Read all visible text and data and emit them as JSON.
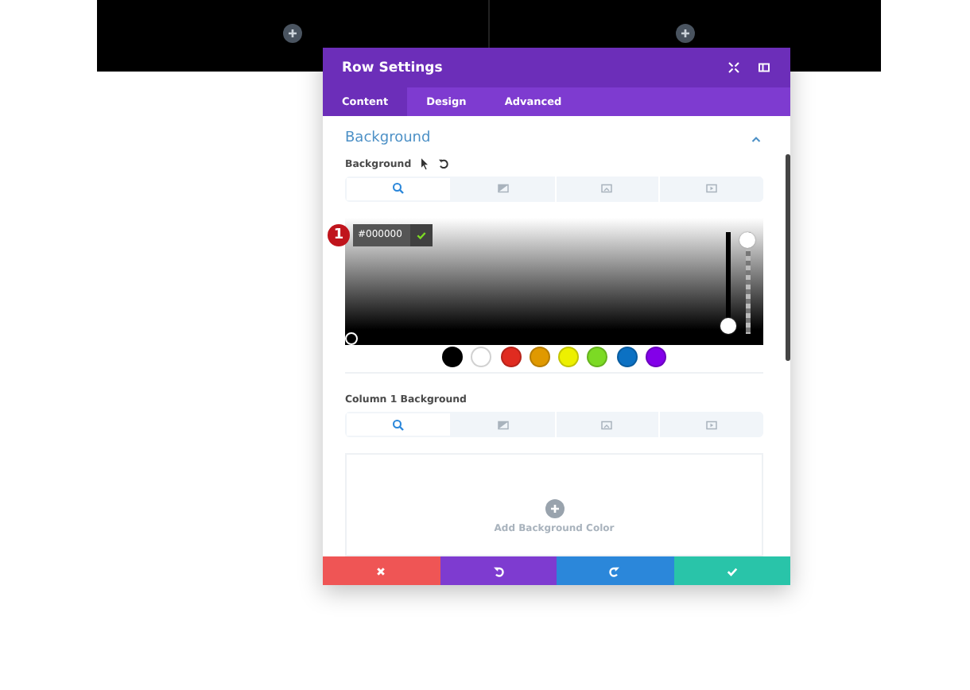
{
  "modal": {
    "title": "Row Settings"
  },
  "tabs": [
    {
      "label": "Content",
      "selected": true
    },
    {
      "label": "Design",
      "selected": false
    },
    {
      "label": "Advanced",
      "selected": false
    }
  ],
  "section": {
    "title": "Background",
    "expanded": true
  },
  "background": {
    "label": "Background",
    "type_tabs": [
      {
        "kind": "color",
        "selected": true
      },
      {
        "kind": "gradient",
        "selected": false
      },
      {
        "kind": "image",
        "selected": false
      },
      {
        "kind": "video",
        "selected": false
      }
    ]
  },
  "color_picker": {
    "badge": "1",
    "hex": "#000000",
    "sliders": [
      {
        "kind": "hue",
        "level": 0
      },
      {
        "kind": "alpha",
        "level": 1
      }
    ],
    "swatches": [
      {
        "color": "#000000"
      },
      {
        "color": "#ffffff"
      },
      {
        "color": "#e02b20"
      },
      {
        "color": "#e09900"
      },
      {
        "color": "#edf000"
      },
      {
        "color": "#7cda24"
      },
      {
        "color": "#0c71c3"
      },
      {
        "color": "#8300e9"
      }
    ]
  },
  "column_background": {
    "label": "Column 1 Background",
    "type_tabs": [
      {
        "kind": "color",
        "selected": true
      },
      {
        "kind": "gradient",
        "selected": false
      },
      {
        "kind": "image",
        "selected": false
      },
      {
        "kind": "video",
        "selected": false
      }
    ],
    "add_label": "Add Background Color"
  },
  "footer_buttons": [
    {
      "kind": "discard",
      "color": "#ef5555"
    },
    {
      "kind": "undo",
      "color": "#7e3bd0"
    },
    {
      "kind": "redo",
      "color": "#2b87da"
    },
    {
      "kind": "save",
      "color": "#29c4a9"
    }
  ]
}
